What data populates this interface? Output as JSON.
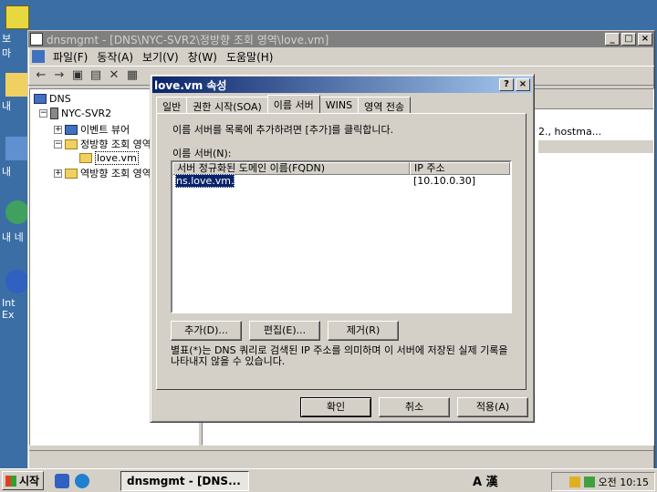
{
  "desktop": {
    "labels": [
      "보안\n마",
      "내",
      "내",
      "내 네",
      "Int\nEx"
    ]
  },
  "main_window": {
    "title": "dnsmgmt - [DNS\\NYC-SVR2\\정방향 조회 영역\\love.vm]",
    "menu": [
      "파일(F)",
      "동작(A)",
      "보기(V)",
      "창(W)",
      "도움말(H)"
    ],
    "tree": [
      "DNS",
      "NYC-SVR2",
      "이벤트 뷰어",
      "정방향 조회 영역",
      "love.vm",
      "역방향 조회 영역"
    ],
    "right_text": "2., hostma..."
  },
  "dialog": {
    "title": "love.vm 속성",
    "tabs": [
      "일반",
      "권한 시작(SOA)",
      "이름 서버",
      "WINS",
      "영역 전송"
    ],
    "instruction": "이름 서버를 목록에 추가하려면 [추가]를 클릭합니다.",
    "list_label": "이름 서버(N):",
    "columns": [
      "서버 정규화된 도메인 이름(FQDN)",
      "IP 주소"
    ],
    "rows": [
      {
        "fqdn": "ns.love.vm.",
        "ip": "[10.10.0.30]"
      }
    ],
    "add": "추가(D)...",
    "edit": "편집(E)...",
    "remove": "제거(R)",
    "note": "별표(*)는 DNS 쿼리로 검색된 IP 주소를 의미하며 이 서버에 저장된 실제 기록을 나타내지 않을 수 있습니다.",
    "ok": "확인",
    "cancel": "취소",
    "apply": "적용(A)"
  },
  "taskbar": {
    "start": "시작",
    "task": "dnsmgmt - [DNS...",
    "time": "오전 10:15",
    "ime": "A 漢"
  }
}
